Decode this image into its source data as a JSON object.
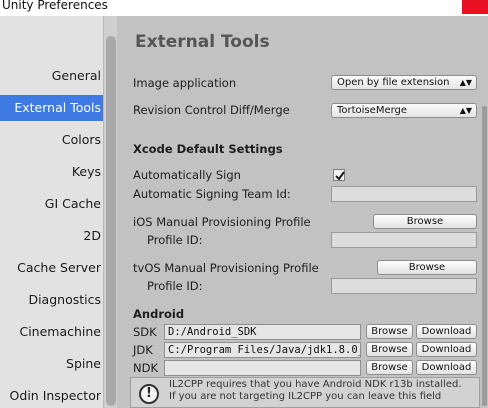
{
  "window": {
    "title": "Unity Preferences"
  },
  "sidebar": {
    "items": [
      {
        "label": "General"
      },
      {
        "label": "External Tools"
      },
      {
        "label": "Colors"
      },
      {
        "label": "Keys"
      },
      {
        "label": "GI Cache"
      },
      {
        "label": "2D"
      },
      {
        "label": "Cache Server"
      },
      {
        "label": "Diagnostics"
      },
      {
        "label": "Cinemachine"
      },
      {
        "label": "Spine"
      },
      {
        "label": "Odin Inspector"
      }
    ],
    "selected": "External Tools"
  },
  "main": {
    "heading": "External Tools",
    "image_application": {
      "label": "Image application",
      "value": "Open by file extension"
    },
    "revision_control": {
      "label": "Revision Control Diff/Merge",
      "value": "TortoiseMerge"
    },
    "xcode": {
      "section": "Xcode Default Settings",
      "auto_sign_label": "Automatically Sign",
      "auto_sign_checked": true,
      "team_id_label": "Automatic Signing Team Id:",
      "ios_profile_label": "iOS Manual Provisioning Profile",
      "ios_profile_id_label": "Profile ID:",
      "tvos_profile_label": "tvOS Manual Provisioning Profile",
      "tvos_profile_id_label": "Profile ID:",
      "browse_label": "Browse"
    },
    "android": {
      "section": "Android",
      "sdk": {
        "label": "SDK",
        "value": "D:/Android_SDK"
      },
      "jdk": {
        "label": "JDK",
        "value": "C:/Program Files/Java/jdk1.8.0_1"
      },
      "ndk": {
        "label": "NDK",
        "value": ""
      },
      "browse_label": "Browse",
      "download_label": "Download"
    },
    "help": {
      "icon": "!",
      "line1": "IL2CPP requires that you have Android NDK r13b installed.",
      "line2": "If you are not targeting IL2CPP you can leave this field"
    }
  }
}
